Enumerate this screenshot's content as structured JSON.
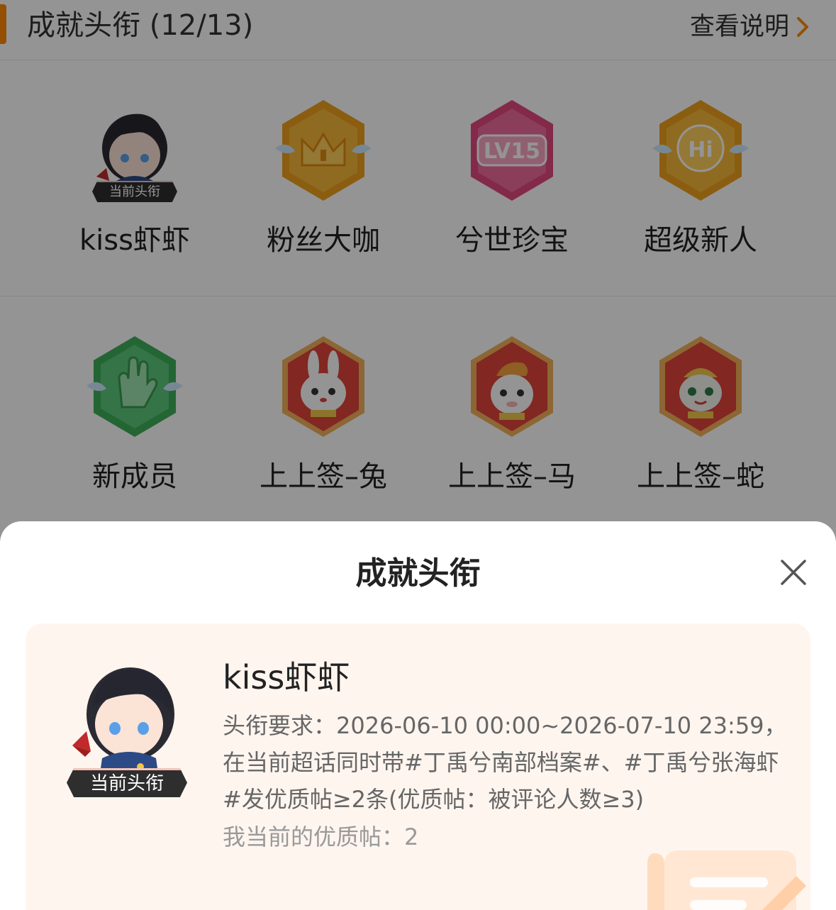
{
  "section": {
    "title": "成就头衔 (12/13)",
    "view_desc": "查看说明"
  },
  "colors": {
    "accent": "#ff8a00",
    "gold": "#f5a623",
    "pink": "#e8508a",
    "green": "#4cc46a",
    "red": "#e8433a"
  },
  "badges": [
    {
      "label": "kiss虾虾",
      "icon": "avatar-portrait-icon",
      "current_tag": "当前头衔"
    },
    {
      "label": "粉丝大咖",
      "icon": "crown-hexagon-icon"
    },
    {
      "label": "兮世珍宝",
      "icon": "lv15-hexagon-icon",
      "badge_text": "LV15"
    },
    {
      "label": "超级新人",
      "icon": "hi-hexagon-icon",
      "badge_text": "Hi"
    },
    {
      "label": "新成员",
      "icon": "hand-hexagon-icon"
    },
    {
      "label": "上上签–兔",
      "icon": "rabbit-hexagon-icon"
    },
    {
      "label": "上上签–马",
      "icon": "horse-hexagon-icon"
    },
    {
      "label": "上上签–蛇",
      "icon": "snake-hexagon-icon"
    }
  ],
  "sheet": {
    "title": "成就头衔",
    "close_icon": "close-icon",
    "card": {
      "name": "kiss虾虾",
      "current_tag": "当前头衔",
      "requirement": "头衔要求：2026-06-10 00:00~2026-07-10 23:59，在当前超话同时带#丁禹兮南部档案#、#丁禹兮张海虾#发优质帖≥2条(优质帖：被评论人数≥3)",
      "my_posts": "我当前的优质帖：2"
    }
  }
}
